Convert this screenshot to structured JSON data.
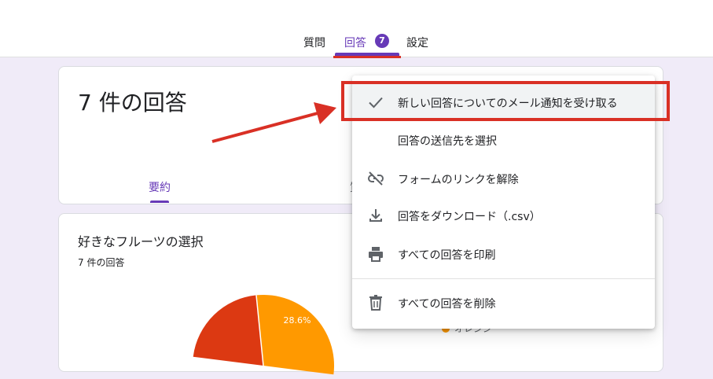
{
  "tabs": {
    "questions": "質問",
    "responses": "回答",
    "response_badge": "7",
    "settings": "設定"
  },
  "summary_card": {
    "title": "7 件の回答",
    "summary_tab": "要約",
    "other_tab_fragment": "質"
  },
  "question_card": {
    "title": "好きなフルーツの選択",
    "count": "7 件の回答",
    "pie_label": "28.6%",
    "legend_label": "オレンジ"
  },
  "pie": {
    "slices": [
      {
        "label": "28.6%",
        "value": 28.6,
        "color": "#ff9900"
      },
      {
        "label": "",
        "value": 21.4,
        "color": "#dc3912"
      }
    ]
  },
  "menu": {
    "items": [
      {
        "label": "新しい回答についてのメール通知を受け取る",
        "icon": "check-icon",
        "checked": true
      },
      {
        "label": "回答の送信先を選択",
        "icon": "",
        "checked": false
      },
      {
        "label": "フォームのリンクを解除",
        "icon": "unlink-icon",
        "checked": false
      },
      {
        "label": "回答をダウンロード（.csv）",
        "icon": "download-icon",
        "checked": false
      },
      {
        "label": "すべての回答を印刷",
        "icon": "print-icon",
        "checked": false
      },
      {
        "label": "すべての回答を削除",
        "icon": "trash-icon",
        "checked": false
      }
    ]
  },
  "colors": {
    "accent": "#673ab7",
    "annotation": "#d93025",
    "background": "#f0ebf8"
  }
}
